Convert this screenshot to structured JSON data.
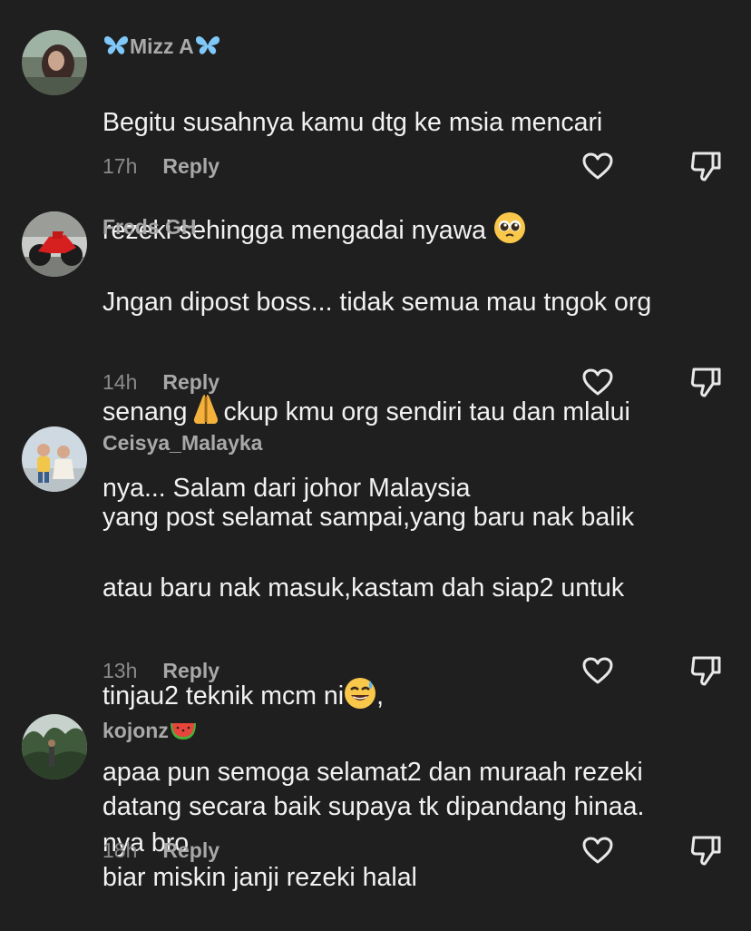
{
  "comments": [
    {
      "username": "Mizz A",
      "avatar_icon": "profile-photo-avatar",
      "text_lines": [
        "Begitu susahnya kamu dtg ke msia mencari",
        "rezeki sehingga mengadai nyawa"
      ],
      "time": "17h",
      "reply_label": "Reply"
    },
    {
      "username": "Freds GH",
      "avatar_icon": "motorbike-avatar",
      "text_part1": "Jngan dipost boss... tidak semua mau tngok org",
      "text_part2": "senang",
      "text_part3": "ckup kmu org sendiri tau dan mlalui",
      "text_part4": "nya... Salam dari johor Malaysia",
      "time": "14h",
      "reply_label": "Reply"
    },
    {
      "username": "Ceisya_Malayka",
      "avatar_icon": "children-avatar",
      "text_line1": "yang post selamat sampai,yang baru nak balik",
      "text_line2": "atau baru nak masuk,kastam dah siap2 untuk",
      "text_line3": "tinjau2 teknik mcm ni",
      "text_line3_end": ",",
      "text_line4": "apaa pun semoga selamat2 dan muraah rezeki",
      "text_line5": "nya bro",
      "time": "13h",
      "reply_label": "Reply"
    },
    {
      "username": "kojonz",
      "avatar_icon": "jungle-avatar",
      "text_line1": "datang secara baik supaya tk dipandang hinaa.",
      "text_line2": "biar miskin janji rezeki halal",
      "time": "18h",
      "reply_label": "Reply"
    }
  ],
  "icons": {
    "like": "heart-outline-icon",
    "dislike": "thumbs-down-outline-icon"
  },
  "colors": {
    "background": "#1f1f1f",
    "username": "#a9a9a9",
    "text": "#f2f2f2",
    "time": "#8a8a8a",
    "butterfly": "#7fc8f8"
  }
}
